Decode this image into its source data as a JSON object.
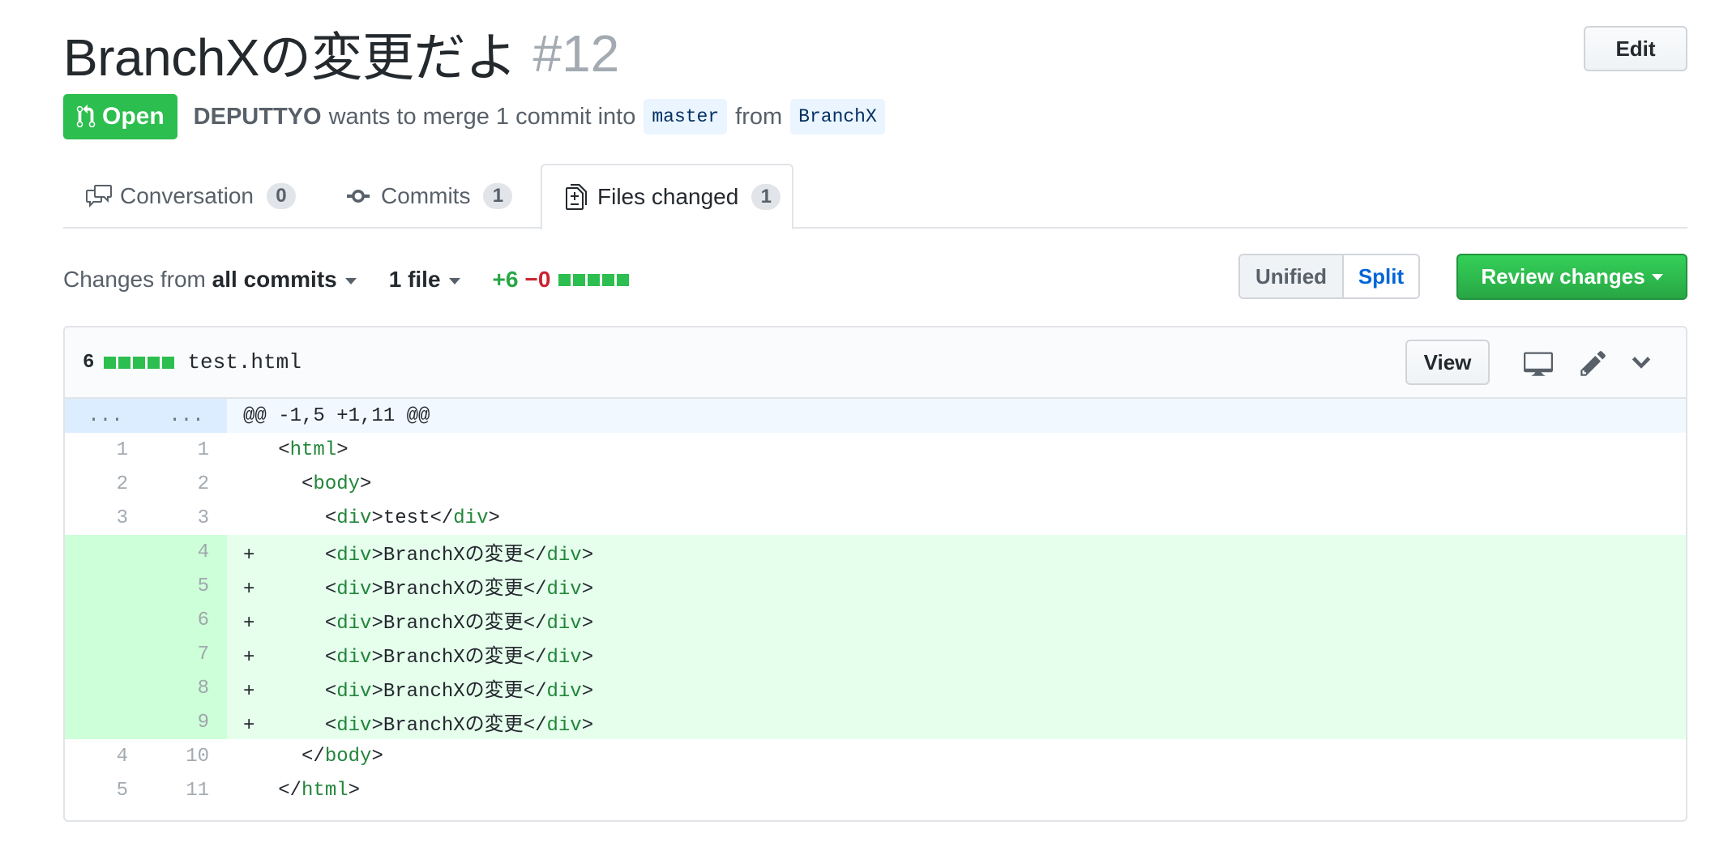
{
  "header": {
    "title": "BranchXの変更だよ",
    "number": "#12",
    "edit_label": "Edit"
  },
  "meta": {
    "state": "Open",
    "author": "DEPUTTYO",
    "action_text": "wants to merge 1 commit into",
    "base_branch": "master",
    "from_text": "from",
    "head_branch": "BranchX"
  },
  "tabs": [
    {
      "label": "Conversation",
      "count": "0",
      "icon": "comment-discussion-icon"
    },
    {
      "label": "Commits",
      "count": "1",
      "icon": "git-commit-icon"
    },
    {
      "label": "Files changed",
      "count": "1",
      "icon": "file-diff-icon",
      "selected": true
    }
  ],
  "toolbar": {
    "changes_prefix": "Changes from",
    "changes_value": "all commits",
    "file_count": "1 file",
    "additions": "+6",
    "deletions": "−0",
    "unified_label": "Unified",
    "split_label": "Split",
    "review_label": "Review changes"
  },
  "file": {
    "change_count": "6",
    "name": "test.html",
    "view_label": "View",
    "hunk_header": "@@ -1,5 +1,11 @@",
    "expand_left": "...",
    "expand_right": "...",
    "lines": [
      {
        "old": "1",
        "new": "1",
        "type": "context",
        "sign": " ",
        "indent": "",
        "open": "html",
        "text": "",
        "close": ""
      },
      {
        "old": "2",
        "new": "2",
        "type": "context",
        "sign": " ",
        "indent": "  ",
        "open": "body",
        "text": "",
        "close": ""
      },
      {
        "old": "3",
        "new": "3",
        "type": "context",
        "sign": " ",
        "indent": "    ",
        "open": "div",
        "text": "test",
        "close": "div"
      },
      {
        "old": "",
        "new": "4",
        "type": "add",
        "sign": "+",
        "indent": "    ",
        "open": "div",
        "text": "BranchXの変更",
        "close": "div"
      },
      {
        "old": "",
        "new": "5",
        "type": "add",
        "sign": "+",
        "indent": "    ",
        "open": "div",
        "text": "BranchXの変更",
        "close": "div"
      },
      {
        "old": "",
        "new": "6",
        "type": "add",
        "sign": "+",
        "indent": "    ",
        "open": "div",
        "text": "BranchXの変更",
        "close": "div"
      },
      {
        "old": "",
        "new": "7",
        "type": "add",
        "sign": "+",
        "indent": "    ",
        "open": "div",
        "text": "BranchXの変更",
        "close": "div"
      },
      {
        "old": "",
        "new": "8",
        "type": "add",
        "sign": "+",
        "indent": "    ",
        "open": "div",
        "text": "BranchXの変更",
        "close": "div"
      },
      {
        "old": "",
        "new": "9",
        "type": "add",
        "sign": "+",
        "indent": "    ",
        "open": "div",
        "text": "BranchXの変更",
        "close": "div"
      },
      {
        "old": "4",
        "new": "10",
        "type": "context",
        "sign": " ",
        "indent": "  ",
        "close_only": "body"
      },
      {
        "old": "5",
        "new": "11",
        "type": "context",
        "sign": " ",
        "indent": "",
        "close_only": "html"
      }
    ]
  },
  "colors": {
    "open_green": "#2cbe4e",
    "link_blue": "#0366d6",
    "addition_bg": "#e6ffed",
    "addition_num_bg": "#cdffd8",
    "hunk_bg": "#f1f8ff",
    "deletion_red": "#cb2431"
  }
}
